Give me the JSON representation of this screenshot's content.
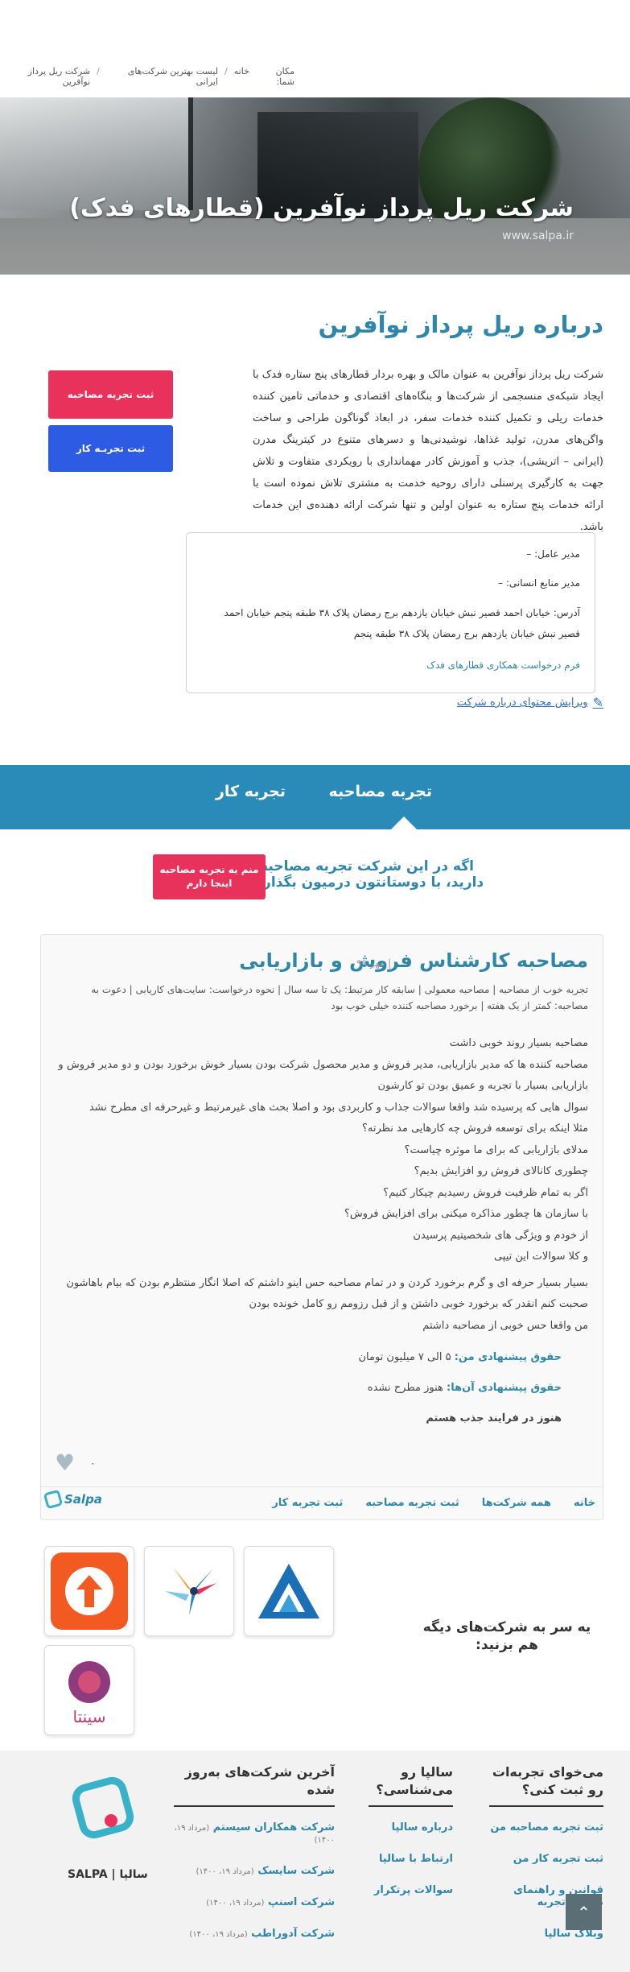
{
  "breadcrumb": {
    "label": "مکان شما:",
    "home": "خانه",
    "list": "لیست بهترین شرکت‌های ایرانی",
    "current": "شرکت ریل پرداز نوآفرین"
  },
  "hero": {
    "title": "شرکت ریل پرداز نوآفرین (قطارهای فدک)",
    "url": "www.salpa.ir"
  },
  "about": {
    "title": "درباره ریل پرداز نوآفرین",
    "text": "شرکت ریل پرداز نوآفرین به عنوان مالک و بهره بردار قطارهای پنج ستاره فدک با ایجاد شبکه‌ی منسجمی از شرکت‌ها و بنگاه‌های اقتصادی و خدماتی تامین کننده خدمات ریلی و تکمیل کننده خدمات سفر، در ابعاد گوناگون طراحی و ساخت واگن‌های مدرن، تولید غذاها، نوشیدنی‌ها و دسرهای متنوع در کیترینگ مدرن (ایرانی – اتریشی)، جذب و آموزش کادر مهمانداری با رویکردی متفاوت و تلاش جهت به کارگیری پرسنلی دارای روحیه خدمت به مشتری تلاش نموده است با ارائه خدمات پنج ستاره به عنوان اولین و تنها شرکت ارائه دهنده‌ی این خدمات باشد.",
    "btn_interview": "ثبت تجربه مصاحبه",
    "btn_work": "ثبت تجربـه کار"
  },
  "info": {
    "ceo": "مدیر عامل: –",
    "hr": "مدیر منابع انسانی: –",
    "address": "آدرس: خیابان احمد قصیر نبش خیابان یازدهم برج رمضان پلاک ۳۸ طبقه پنجم خیابان احمد قصیر نبش خیابان یازدهم برج رمضان پلاک ۳۸ طبقه پنجم",
    "form_link": "فرم درخواست همکاری قطارهای فدک",
    "edit_link": "ویرایش محتوای درباره شرکت"
  },
  "tabs": {
    "interview": "تجربه مصاحبه",
    "work": "تجربه کار"
  },
  "cta": {
    "text": "اگه در این شرکت تجربه مصاحبه دارید، با دوستانتون درمیون بگذارید",
    "button": "منم یه تجربه مصاحبه اینجا دارم"
  },
  "review": {
    "title": "مصاحبه کارشناس فروش و بازاریابی",
    "date": "| مهر ۹۹",
    "meta": "تجربه خوب از مصاحبه | مصاحبه معمولی | سابقه کار مرتبط: یک تا سه سال | نحوه درخواست: سایت‌های کاریابی | دعوت به مصاحبه: کمتر از یک هفته | برخورد مصاحبه کننده خیلی خوب بود",
    "lines": [
      "مصاحبه بسیار روند خوبی داشت",
      "مصاحبه کننده ها که مدیر بازاریابی، مدیر فروش و مدیر محصول شرکت بودن بسیار خوش برخورد بودن و دو مدیر فروش و بازاریابی بسیار با تجربه و عمیق بودن تو کارشون",
      "سوال هایی که پرسیده شد واقعا سوالات جذاب و کاربردی بود و اصلا بحث های غیرمرتبط و غیرحرفه ای مطرح نشد",
      "مثلا اینکه برای توسعه فروش چه کارهایی مد نظرته؟",
      "مدلای بازاریابی که برای ما موثره چیاست؟",
      "چطوری کانالای فروش رو افزایش بدیم؟",
      "اگر به تمام ظرفیت فروش رسیدیم چیکار کنیم؟",
      "با سازمان ها چطور مذاکره میکنی برای افزایش فروش؟",
      "از خودم و ویژگی های شخصیتیم پرسیدن",
      "و کلا سوالات این تیپی"
    ],
    "closing": "بسیار بسیار حرفه ای و گرم برخورد کردن و در تمام مصاحبه حس اینو داشتم که اصلا انگار منتظرم بودن که بیام باهاشون صحبت کنم انقدر که برخورد خوبی داشتن و از قبل رزومم رو کامل خونده بودن",
    "closing2": "من واقعا حس خوبی از مصاحبه داشتم",
    "salary_mine_label": "حقوق پیشنهادی من:",
    "salary_mine": "۵ الی ۷ میلیون تومان",
    "salary_theirs_label": "حقوق پیشنهادی آن‌ها:",
    "salary_theirs": "هنوز مطرح نشده",
    "status": "هنوز در فرایند جذب هستم",
    "likes": "۰"
  },
  "card_nav": [
    "خانه",
    "همه شرکت‌ها",
    "ثبت تجربه مصاحبه",
    "ثبت تجربه کار"
  ],
  "card_logo": "Salpa",
  "others": {
    "title": "یه سر به شرکت‌های دیگه هم بزنید:"
  },
  "footer": {
    "col1_title": "می‌خوای تجربه‌ات رو ثبت کنی؟",
    "col1_items": [
      "ثبت تجربه مصاحبه من",
      "ثبت تجربه کار من",
      "قوانین و راهنمای نگارش تجربه",
      "وبلاگ سالپا"
    ],
    "col2_title": "سالپا رو می‌شناسی؟",
    "col2_items": [
      "درباره سالپا",
      "ارتباط با سالپا",
      "سوالات پرتکرار"
    ],
    "col3_title": "آخرین شرکت‌های به‌روز شده",
    "col3_items": [
      {
        "name": "شرکت همکاران سیستم",
        "date": "(مرداد ۱۹، ۱۴۰۰)"
      },
      {
        "name": "شرکت سایسک",
        "date": "(مرداد ۱۹، ۱۴۰۰)"
      },
      {
        "name": "شرکت اسنپ",
        "date": "(مرداد ۱۹، ۱۴۰۰)"
      },
      {
        "name": "شرکت آدوراطب",
        "date": "(مرداد ۱۹، ۱۴۰۰)"
      }
    ],
    "brand": "سالپا | SALPA"
  },
  "colors": {
    "primary": "#2e86ab",
    "pink": "#e8315b",
    "blue": "#2d5be3",
    "tabbar": "#2a8bb8"
  }
}
